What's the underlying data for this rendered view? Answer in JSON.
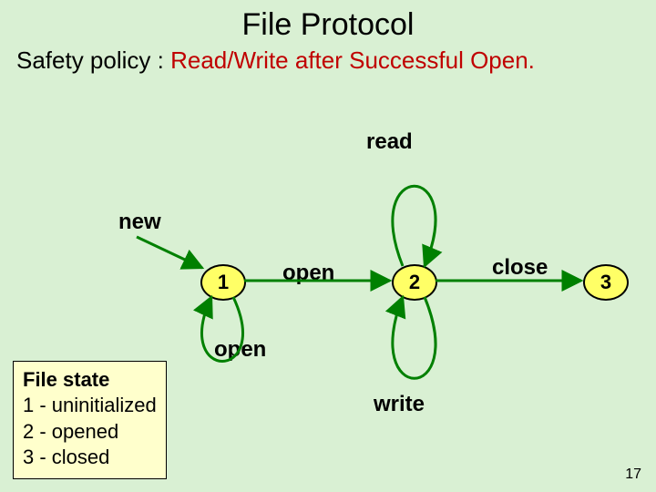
{
  "title": "File Protocol",
  "policy_prefix": "Safety policy : ",
  "policy_highlight": "Read/Write after Successful Open.",
  "labels": {
    "new": "new",
    "read": "read",
    "open_top": "open",
    "open_bottom": "open",
    "close": "close",
    "write": "write"
  },
  "states": {
    "s1": "1",
    "s2": "2",
    "s3": "3"
  },
  "legend": {
    "heading": "File state",
    "l1": "1 - uninitialized",
    "l2": "2 - opened",
    "l3": "3 - closed"
  },
  "slide_number": "17",
  "chart_data": {
    "type": "state-diagram",
    "title": "File Protocol",
    "states": [
      {
        "id": 1,
        "label": "uninitialized"
      },
      {
        "id": 2,
        "label": "opened"
      },
      {
        "id": 3,
        "label": "closed"
      }
    ],
    "initial": 1,
    "transitions": [
      {
        "from": null,
        "to": 1,
        "label": "new"
      },
      {
        "from": 1,
        "to": 2,
        "label": "open"
      },
      {
        "from": 1,
        "to": 1,
        "label": "open"
      },
      {
        "from": 2,
        "to": 2,
        "label": "read"
      },
      {
        "from": 2,
        "to": 2,
        "label": "write"
      },
      {
        "from": 2,
        "to": 3,
        "label": "close"
      }
    ]
  }
}
